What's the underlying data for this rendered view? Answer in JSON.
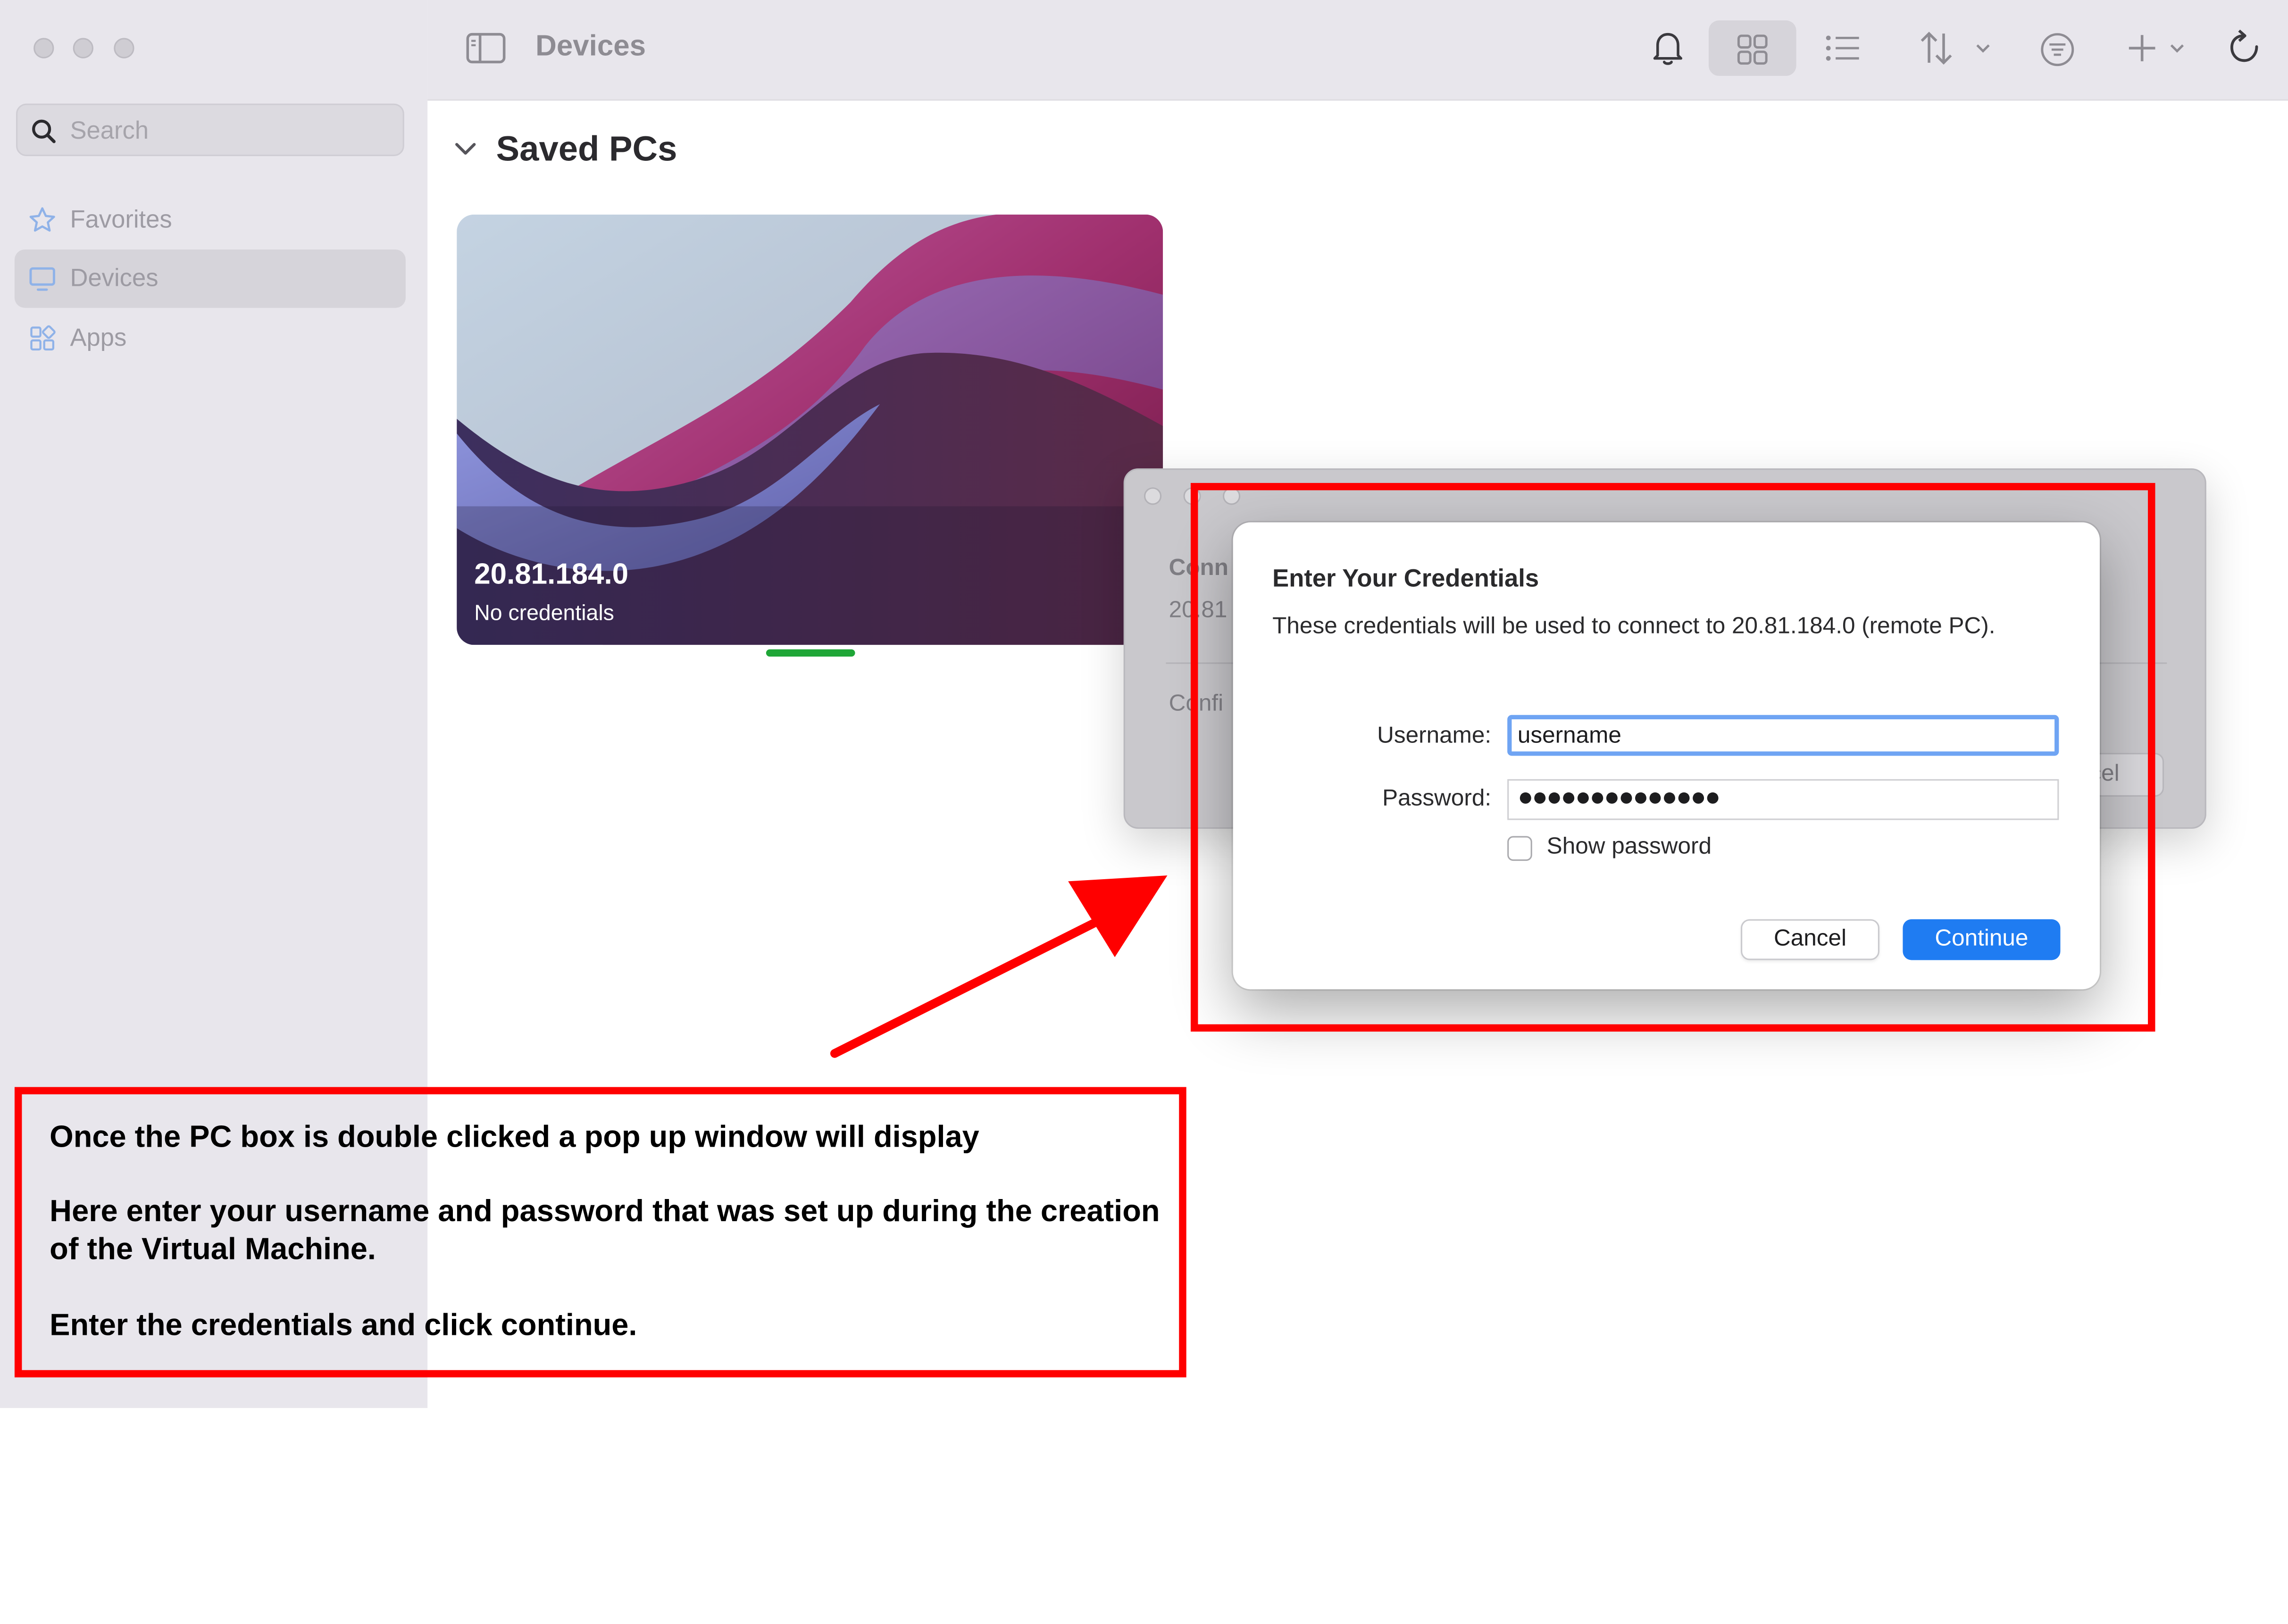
{
  "window": {
    "title": "Devices"
  },
  "sidebar": {
    "search_placeholder": "Search",
    "items": [
      {
        "label": "Favorites",
        "icon": "star-icon"
      },
      {
        "label": "Devices",
        "icon": "monitor-icon",
        "selected": true
      },
      {
        "label": "Apps",
        "icon": "apps-grid-icon"
      }
    ]
  },
  "toolbar": {
    "icons": [
      "sidebar-toggle-icon",
      "bell-icon",
      "grid-view-icon",
      "list-view-icon",
      "sort-icon",
      "filter-icon",
      "add-icon",
      "refresh-icon"
    ]
  },
  "content": {
    "section_title": "Saved PCs"
  },
  "pc_card": {
    "ip": "20.81.184.0",
    "status": "No credentials"
  },
  "background_dialog": {
    "heading_fragment": "Conn",
    "address_fragment": "20.81",
    "status_fragment": "Confi",
    "button_fragment": "cel"
  },
  "credentials_dialog": {
    "title": "Enter Your Credentials",
    "description": "These credentials will be used to connect to 20.81.184.0 (remote PC).",
    "username_label": "Username:",
    "username_value": "username",
    "password_label": "Password:",
    "password_value": "●●●●●●●●●●●●●●",
    "show_password_label": "Show password",
    "cancel_label": "Cancel",
    "continue_label": "Continue"
  },
  "annotation": {
    "line1": "Once the PC box is double clicked a pop up window will display",
    "line2": "Here enter your username and password that was set up during the creation of the Virtual Machine.",
    "line3": "Enter the credentials and click continue."
  },
  "colors": {
    "accent": "#1f7cf2",
    "annotation_red": "#ff0000",
    "progress_green": "#1fa637",
    "sidebar_bg": "#e8e6ec"
  }
}
